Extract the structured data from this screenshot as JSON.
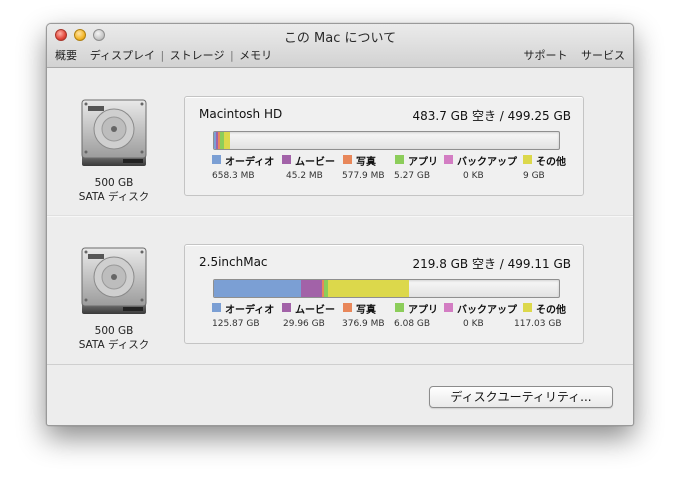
{
  "window": {
    "title": "この Mac について"
  },
  "toolbar": {
    "left": [
      "概要",
      "ディスプレイ",
      "ストレージ",
      "メモリ"
    ],
    "right": [
      "サポート",
      "サービス"
    ]
  },
  "legend_labels": [
    "オーディオ",
    "ムービー",
    "写真",
    "アプリ",
    "バックアップ",
    "その他"
  ],
  "colors": {
    "audio": "#7b9fd4",
    "movies": "#a262a8",
    "photos": "#e8875a",
    "apps": "#8ccd5a",
    "backups": "#d37dc3",
    "other": "#dcd84b"
  },
  "disks": [
    {
      "name": "Macintosh HD",
      "space": "483.7 GB 空き / 499.25 GB",
      "capacity": "500 GB",
      "interface": "SATA ディスク",
      "values": [
        "658.3 MB",
        "45.2 MB",
        "577.9 MB",
        "5.27 GB",
        "0 KB",
        "9 GB"
      ],
      "usage_fraction": {
        "audio": 0.0013,
        "movies": 0.0001,
        "photos": 0.0012,
        "apps": 0.0106,
        "backups": 0.0,
        "other": 0.018
      }
    },
    {
      "name": "2.5inchMac",
      "space": "219.8 GB 空き / 499.11 GB",
      "capacity": "500 GB",
      "interface": "SATA ディスク",
      "values": [
        "125.87 GB",
        "29.96 GB",
        "376.9 MB",
        "6.08 GB",
        "0 KB",
        "117.03 GB"
      ],
      "usage_fraction": {
        "audio": 0.2522,
        "movies": 0.06,
        "photos": 0.0008,
        "apps": 0.0122,
        "backups": 0.0,
        "other": 0.2345
      }
    }
  ],
  "footer": {
    "disk_utility_button": "ディスクユーティリティ..."
  }
}
